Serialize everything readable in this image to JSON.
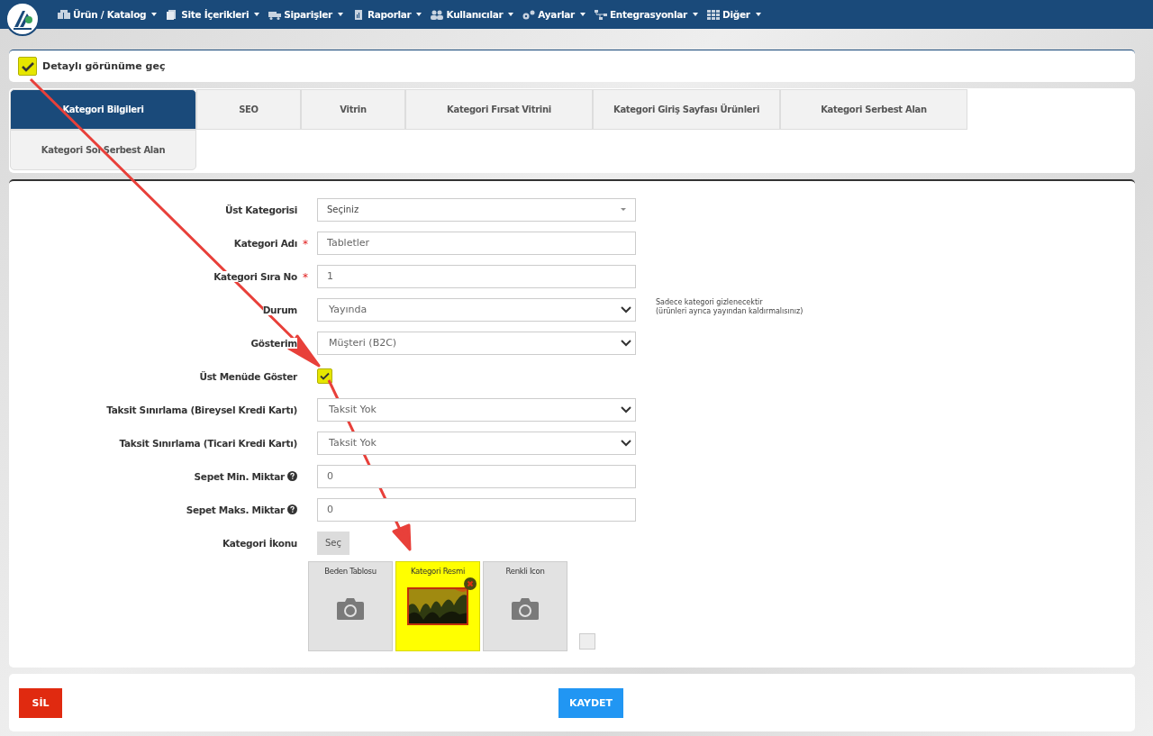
{
  "nav": {
    "items": [
      {
        "label": "Ürün / Katalog"
      },
      {
        "label": "Site İçerikleri"
      },
      {
        "label": "Siparişler"
      },
      {
        "label": "Raporlar"
      },
      {
        "label": "Kullanıcılar"
      },
      {
        "label": "Ayarlar"
      },
      {
        "label": "Entegrasyonlar"
      },
      {
        "label": "Diğer"
      }
    ]
  },
  "detail_toggle": {
    "label": "Detaylı görünüme geç",
    "checked": true,
    "highlighted": true
  },
  "tabs": [
    {
      "label": "Kategori Bilgileri",
      "selected": true
    },
    {
      "label": "SEO",
      "selected": false
    },
    {
      "label": "Vitrin",
      "selected": false
    },
    {
      "label": "Kategori Fırsat Vitrini",
      "selected": false
    },
    {
      "label": "Kategori Giriş Sayfası Ürünleri",
      "selected": false
    },
    {
      "label": "Kategori Serbest Alan",
      "selected": false
    },
    {
      "label": "Kategori Sol Serbest Alan",
      "selected": false
    }
  ],
  "form": [
    {
      "kind": "combo",
      "label": "Üst Kategorisi",
      "value": "Seçiniz"
    },
    {
      "kind": "text",
      "label": "Kategori Adı",
      "required_mark": "*",
      "value": "Tabletler"
    },
    {
      "kind": "text",
      "label": "Kategori Sıra No",
      "required_mark": "*",
      "value": "1"
    },
    {
      "kind": "select",
      "label": "Durum",
      "value": "Yayında",
      "note": "Sadece kategori gizlenecektir\n(ürünleri ayrıca yayından kaldırmalısınız)"
    },
    {
      "kind": "select",
      "label": "Gösterim",
      "value": "Müşteri (B2C)"
    },
    {
      "kind": "checkbox",
      "label": "Üst Menüde Göster",
      "checked": true,
      "highlighted": true
    },
    {
      "kind": "select",
      "label": "Taksit Sınırlama (Bireysel Kredi Kartı)",
      "value": "Taksit Yok"
    },
    {
      "kind": "select",
      "label": "Taksit Sınırlama (Ticari Kredi Kartı)",
      "value": "Taksit Yok"
    },
    {
      "kind": "text",
      "label": "Sepet Min. Miktar",
      "help": true,
      "value": "0"
    },
    {
      "kind": "text",
      "label": "Sepet Maks. Miktar",
      "help": true,
      "value": "0"
    },
    {
      "kind": "button",
      "label": "Kategori İkonu",
      "button": "Seç"
    }
  ],
  "images": [
    {
      "title": "Beden Tablosu",
      "has_image": false,
      "highlighted": false
    },
    {
      "title": "Kategori Resmi",
      "has_image": true,
      "highlighted": true
    },
    {
      "title": "Renkli Icon",
      "has_image": false,
      "highlighted": false
    }
  ],
  "extra_checkbox": {
    "checked": false
  },
  "footer": {
    "delete": "SİL",
    "save": "KAYDET"
  }
}
